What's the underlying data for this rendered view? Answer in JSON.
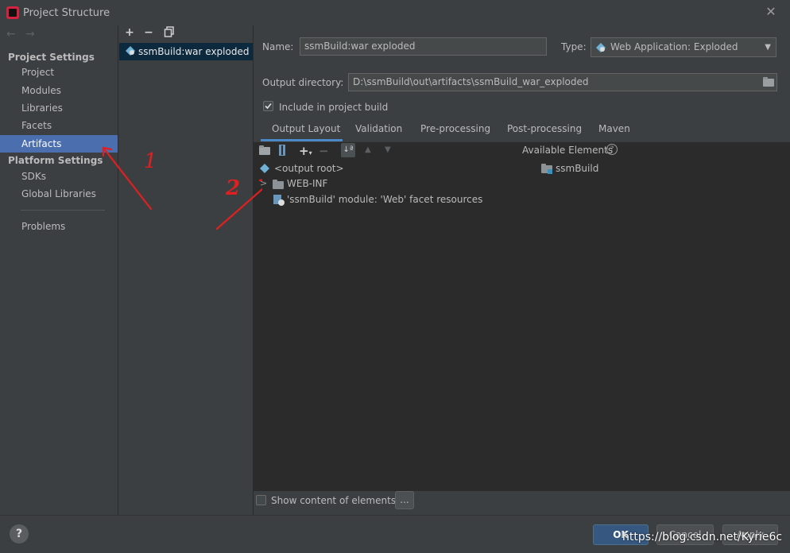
{
  "window": {
    "title": "Project Structure",
    "close_icon": "close-icon"
  },
  "nav": {
    "back_arrow": "←",
    "forward_arrow": "→",
    "project_settings_header": "Project Settings",
    "project_items": [
      "Project",
      "Modules",
      "Libraries",
      "Facets",
      "Artifacts"
    ],
    "platform_settings_header": "Platform Settings",
    "platform_items": [
      "SDKs",
      "Global Libraries"
    ],
    "problems": "Problems",
    "selected": "Artifacts"
  },
  "artifacts_list": {
    "add": "+",
    "remove": "−",
    "copy_icon": "copy-icon",
    "items": [
      "ssmBuild:war exploded"
    ]
  },
  "artifact": {
    "name_label": "Name:",
    "name_value": "ssmBuild:war exploded",
    "type_label": "Type:",
    "type_value": "Web Application: Exploded",
    "output_dir_label": "Output directory:",
    "output_dir_value": "D:\\ssmBuild\\out\\artifacts\\ssmBuild_war_exploded",
    "include_in_build_label": "Include in project build",
    "include_in_build_checked": true
  },
  "tabs": [
    "Output Layout",
    "Validation",
    "Pre-processing",
    "Post-processing",
    "Maven"
  ],
  "selected_tab": "Output Layout",
  "output_layout": {
    "tree": {
      "root": "<output root>",
      "children": [
        {
          "label": "WEB-INF",
          "type": "folder",
          "expandable": true
        },
        {
          "label": "'ssmBuild' module: 'Web' facet resources",
          "type": "facet"
        }
      ]
    },
    "available_elements_label": "Available Elements",
    "available_elements": [
      "ssmBuild"
    ],
    "show_content_label": "Show content of elements",
    "show_content_checked": false,
    "ellipsis_button": "..."
  },
  "footer": {
    "help": "?",
    "ok": "OK",
    "cancel": "Cancel",
    "apply": "Apply",
    "watermark": "https://blog.csdn.net/Kyrie6c"
  },
  "annotations": {
    "one": "1",
    "two": "2",
    "color": "#e02020"
  },
  "colors": {
    "selection": "#4b6eaf",
    "accent": "#4a88c7",
    "background": "#3c3f41"
  }
}
